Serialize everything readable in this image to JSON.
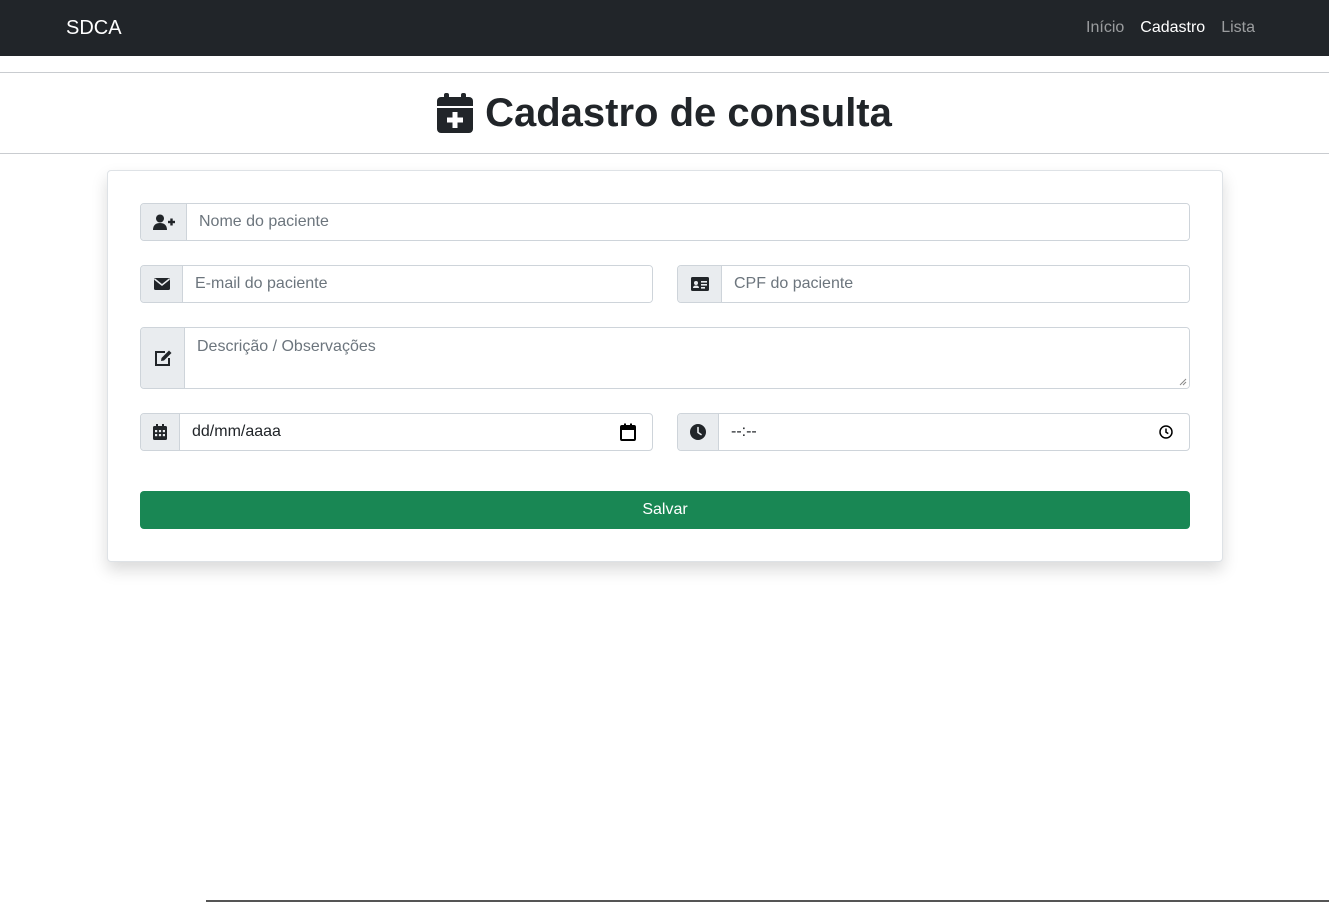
{
  "navbar": {
    "brand": "SDCA",
    "links": [
      {
        "label": "Início",
        "active": false
      },
      {
        "label": "Cadastro",
        "active": true
      },
      {
        "label": "Lista",
        "active": false
      }
    ]
  },
  "header": {
    "title": "Cadastro de consulta",
    "icon": "calendar-plus-icon"
  },
  "form": {
    "name_placeholder": "Nome do paciente",
    "email_placeholder": "E-mail do paciente",
    "cpf_placeholder": "CPF do paciente",
    "description_placeholder": "Descrição / Observações",
    "date_value": "dd/mm/aaaa",
    "time_value": "--:--",
    "save_label": "Salvar"
  },
  "colors": {
    "navbar_bg": "#212529",
    "save_button": "#198754",
    "addon_bg": "#e9ecef"
  }
}
